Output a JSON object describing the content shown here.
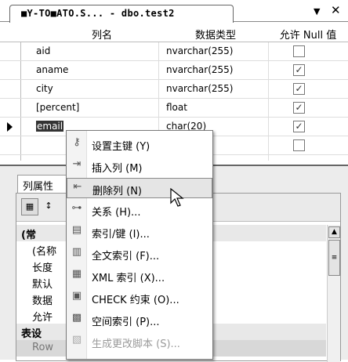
{
  "tab": {
    "label": "■Y-TO■ATO.S... - dbo.test2",
    "dropdown_icon": "chevron-down-icon",
    "close_icon": "close-icon"
  },
  "grid": {
    "headers": [
      "列名",
      "数据类型",
      "允许 Null 值"
    ],
    "rows": [
      {
        "name": "aid",
        "type": "nvarchar(255)",
        "nullable": false
      },
      {
        "name": "aname",
        "type": "nvarchar(255)",
        "nullable": true
      },
      {
        "name": "city",
        "type": "nvarchar(255)",
        "nullable": true
      },
      {
        "name": "[percent]",
        "type": "float",
        "nullable": true
      },
      {
        "name": "email",
        "type": "char(20)",
        "nullable": true
      },
      {
        "name": "",
        "type": "",
        "nullable": false
      }
    ]
  },
  "properties": {
    "tab_label": "列属性",
    "rows": [
      {
        "label": "(常",
        "kind": "category"
      },
      {
        "label": "(名称",
        "kind": "item"
      },
      {
        "label": "长度",
        "kind": "item"
      },
      {
        "label": "默认",
        "kind": "item"
      },
      {
        "label": "数据",
        "kind": "item"
      },
      {
        "label": "允许",
        "kind": "item"
      },
      {
        "label": "表设",
        "kind": "category"
      },
      {
        "label": "Row",
        "kind": "item-gray"
      }
    ]
  },
  "context_menu": {
    "items": [
      {
        "label": "设置主键 (Y)",
        "icon": "key-icon",
        "state": "normal"
      },
      {
        "label": "插入列 (M)",
        "icon": "insert-column-icon",
        "state": "normal"
      },
      {
        "label": "删除列 (N)",
        "icon": "delete-column-icon",
        "state": "highlighted"
      },
      {
        "label": "关系 (H)...",
        "icon": "relationship-icon",
        "state": "normal"
      },
      {
        "label": "索引/键 (I)...",
        "icon": "index-key-icon",
        "state": "normal"
      },
      {
        "label": "全文索引 (F)...",
        "icon": "fulltext-index-icon",
        "state": "normal"
      },
      {
        "label": "XML 索引 (X)...",
        "icon": "xml-index-icon",
        "state": "normal"
      },
      {
        "label": "CHECK 约束 (O)...",
        "icon": "check-constraint-icon",
        "state": "normal"
      },
      {
        "label": "空间索引 (P)...",
        "icon": "spatial-index-icon",
        "state": "normal"
      },
      {
        "label": "生成更改脚本 (S)...",
        "icon": "generate-script-icon",
        "state": "disabled"
      }
    ]
  },
  "colors": {
    "highlight": "#e5e5e5",
    "border": "#7a7a7a"
  }
}
